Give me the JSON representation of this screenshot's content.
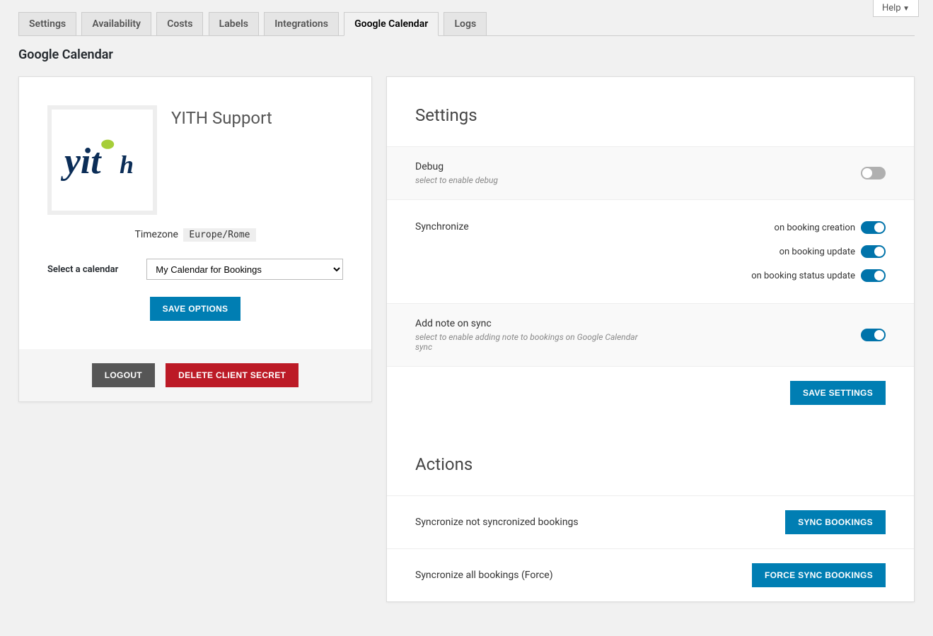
{
  "help_label": "Help",
  "tabs": [
    "Settings",
    "Availability",
    "Costs",
    "Labels",
    "Integrations",
    "Google Calendar",
    "Logs"
  ],
  "active_tab": "Google Calendar",
  "page_title": "Google Calendar",
  "account": {
    "name": "YITH Support",
    "timezone_label": "Timezone",
    "timezone_value": "Europe/Rome",
    "select_calendar_label": "Select a calendar",
    "calendar_selected": "My Calendar for Bookings",
    "save_options_label": "Save Options",
    "logout_label": "Logout",
    "delete_secret_label": "Delete Client Secret"
  },
  "settings_header": "Settings",
  "debug": {
    "label": "Debug",
    "desc": "select to enable debug",
    "on": false
  },
  "synchronize": {
    "label": "Synchronize",
    "items": [
      {
        "label": "on booking creation",
        "on": true
      },
      {
        "label": "on booking update",
        "on": true
      },
      {
        "label": "on booking status update",
        "on": true
      }
    ]
  },
  "add_note": {
    "label": "Add note on sync",
    "desc": "select to enable adding note to bookings on Google Calendar sync",
    "on": true
  },
  "save_settings_label": "Save Settings",
  "actions_header": "Actions",
  "actions": [
    {
      "label": "Syncronize not syncronized bookings",
      "button": "Sync Bookings"
    },
    {
      "label": "Syncronize all bookings (Force)",
      "button": "Force Sync Bookings"
    }
  ]
}
